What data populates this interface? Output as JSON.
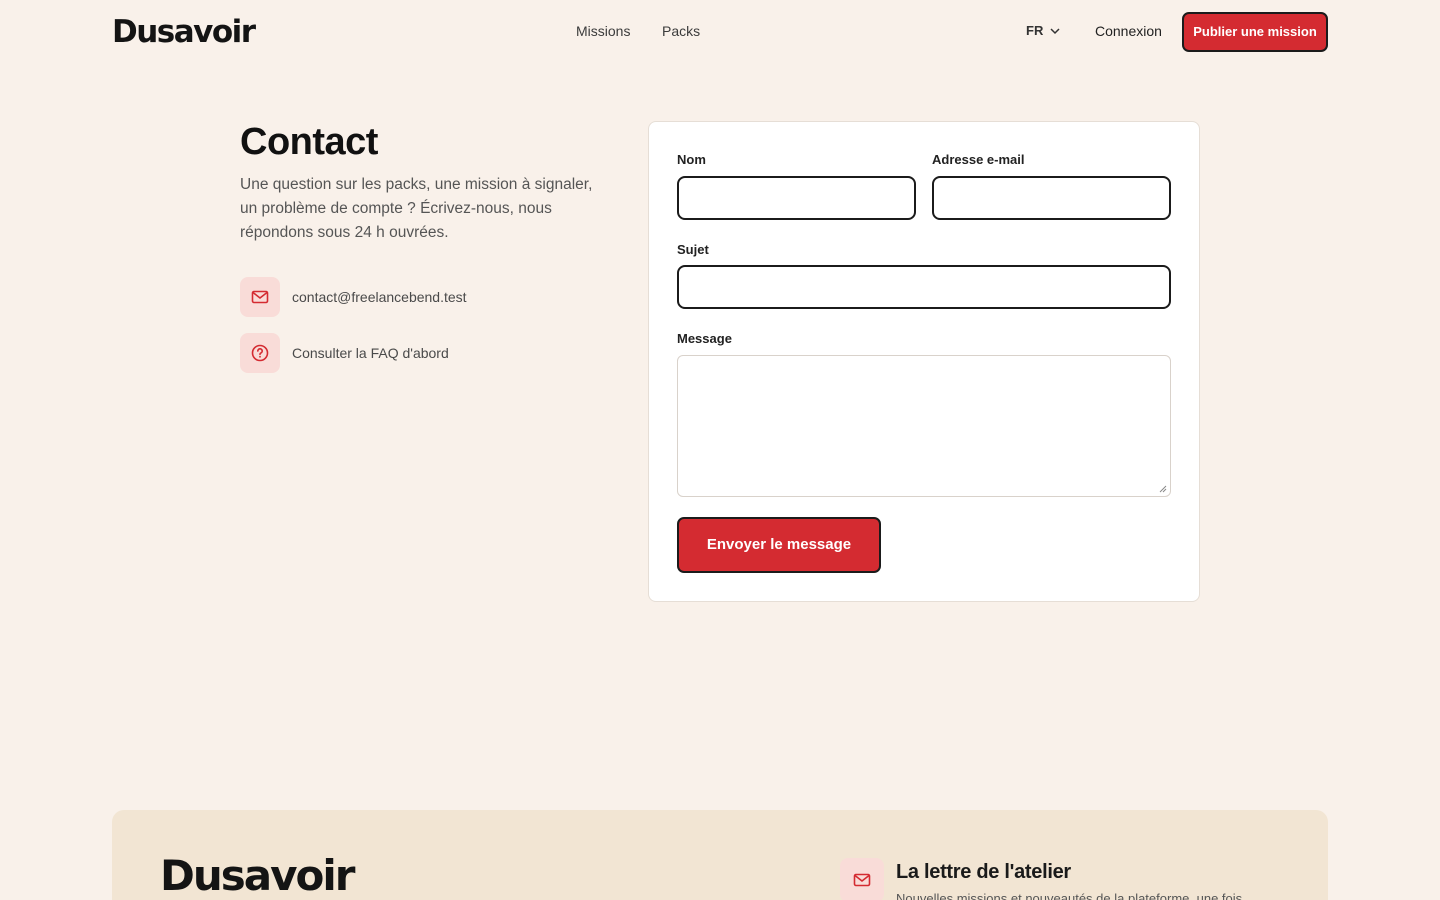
{
  "header": {
    "logo": "Dusavoir",
    "nav": [
      "Missions",
      "Packs"
    ],
    "language": "FR",
    "login_label": "Connexion",
    "cta_label": "Publier une mission"
  },
  "contact": {
    "title": "Contact",
    "intro": "Une question sur les packs, une mission à signaler, un problème de compte ? Écrivez-nous, nous répondons sous 24 h ouvrées.",
    "items": [
      {
        "icon": "mail-icon",
        "text": "contact@freelancebend.test"
      },
      {
        "icon": "help-circle-icon",
        "text": "Consulter la FAQ d'abord"
      }
    ]
  },
  "form": {
    "name_label": "Nom",
    "name_value": "",
    "email_label": "Adresse e-mail",
    "email_value": "",
    "subject_label": "Sujet",
    "subject_value": "",
    "message_label": "Message",
    "message_value": "",
    "submit_label": "Envoyer le message"
  },
  "footer": {
    "logo": "Dusavoir",
    "newsletter_title": "La lettre de l'atelier",
    "newsletter_desc": "Nouvelles missions et nouveautés de la plateforme, une fois"
  },
  "colors": {
    "background": "#f9f1ea",
    "accent": "#d42b31",
    "footer_bg": "#f2e5d3",
    "icon_bg": "#f9dcd8"
  }
}
